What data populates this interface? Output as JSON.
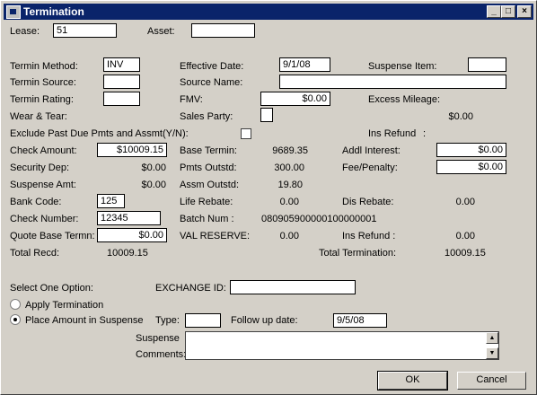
{
  "window": {
    "title": "Termination",
    "minimize": "_",
    "maximize": "□",
    "close": "×"
  },
  "lease": {
    "label": "Lease:",
    "value": "51"
  },
  "asset": {
    "label": "Asset:",
    "value": ""
  },
  "termin_method": {
    "label": "Termin Method:",
    "value": "INV"
  },
  "termin_source": {
    "label": "Termin Source:",
    "value": ""
  },
  "termin_rating": {
    "label": "Termin Rating:",
    "value": ""
  },
  "wear_tear": {
    "label": "Wear & Tear:"
  },
  "effective_date": {
    "label": "Effective Date:",
    "value": "9/1/08"
  },
  "source_name": {
    "label": "Source Name:",
    "value": ""
  },
  "fmv": {
    "label": "FMV:",
    "value": "$0.00"
  },
  "sales_party": {
    "label": "Sales Party:"
  },
  "suspense_item": {
    "label": "Suspense Item:",
    "value": ""
  },
  "excess_mileage": {
    "label": "Excess Mileage:",
    "value": "$0.00"
  },
  "exclude": {
    "label": "Exclude Past Due Pmts and Assmt(Y/N):"
  },
  "ins_refund_top": {
    "label": "Ins Refund",
    "sep": ":"
  },
  "check_amount": {
    "label": "Check Amount:",
    "value": "$10009.15"
  },
  "security_dep": {
    "label": "Security Dep:",
    "value": "$0.00"
  },
  "suspense_amt": {
    "label": "Suspense Amt:",
    "value": "$0.00"
  },
  "bank_code": {
    "label": "Bank Code:",
    "value": "125"
  },
  "check_number": {
    "label": "Check Number:",
    "value": "12345"
  },
  "quote_base": {
    "label": "Quote Base Termn:",
    "value": "$0.00"
  },
  "total_recd": {
    "label": "Total Recd:",
    "value": "10009.15"
  },
  "base_termin": {
    "label": "Base Termin:",
    "value": "9689.35"
  },
  "pmts_outstd": {
    "label": "Pmts Outstd:",
    "value": "300.00"
  },
  "assm_outstd": {
    "label": "Assm Outstd:",
    "value": "19.80"
  },
  "life_rebate": {
    "label": "Life Rebate:",
    "value": "0.00"
  },
  "batch_num": {
    "label": "Batch Num  :",
    "value": "080905900000100000001"
  },
  "val_reserve": {
    "label": "VAL RESERVE:",
    "value": "0.00"
  },
  "addl_interest": {
    "label": "Addl Interest:",
    "value": "$0.00"
  },
  "fee_penalty": {
    "label": "Fee/Penalty:",
    "value": "$0.00"
  },
  "dis_rebate": {
    "label": "Dis Rebate:",
    "value": "0.00"
  },
  "ins_refund_bottom": {
    "label": "Ins Refund   :",
    "value": "0.00"
  },
  "total_termination": {
    "label": "Total Termination:",
    "value": "10009.15"
  },
  "select_option": {
    "label": "Select One Option:"
  },
  "exchange_id": {
    "label": "EXCHANGE ID:",
    "value": ""
  },
  "option_apply": {
    "label": "Apply Termination",
    "selected": false
  },
  "option_suspense": {
    "label": "Place Amount in Suspense",
    "selected": true
  },
  "type": {
    "label": "Type:",
    "value": ""
  },
  "follow_up": {
    "label": "Follow up date:",
    "value": "9/5/08"
  },
  "suspense_comments": {
    "label1": "Suspense",
    "label2": "Comments:",
    "value": ""
  },
  "buttons": {
    "ok": "OK",
    "cancel": "Cancel"
  },
  "colors": {
    "titlebar": "#0a246a",
    "face": "#d4d0c8"
  }
}
